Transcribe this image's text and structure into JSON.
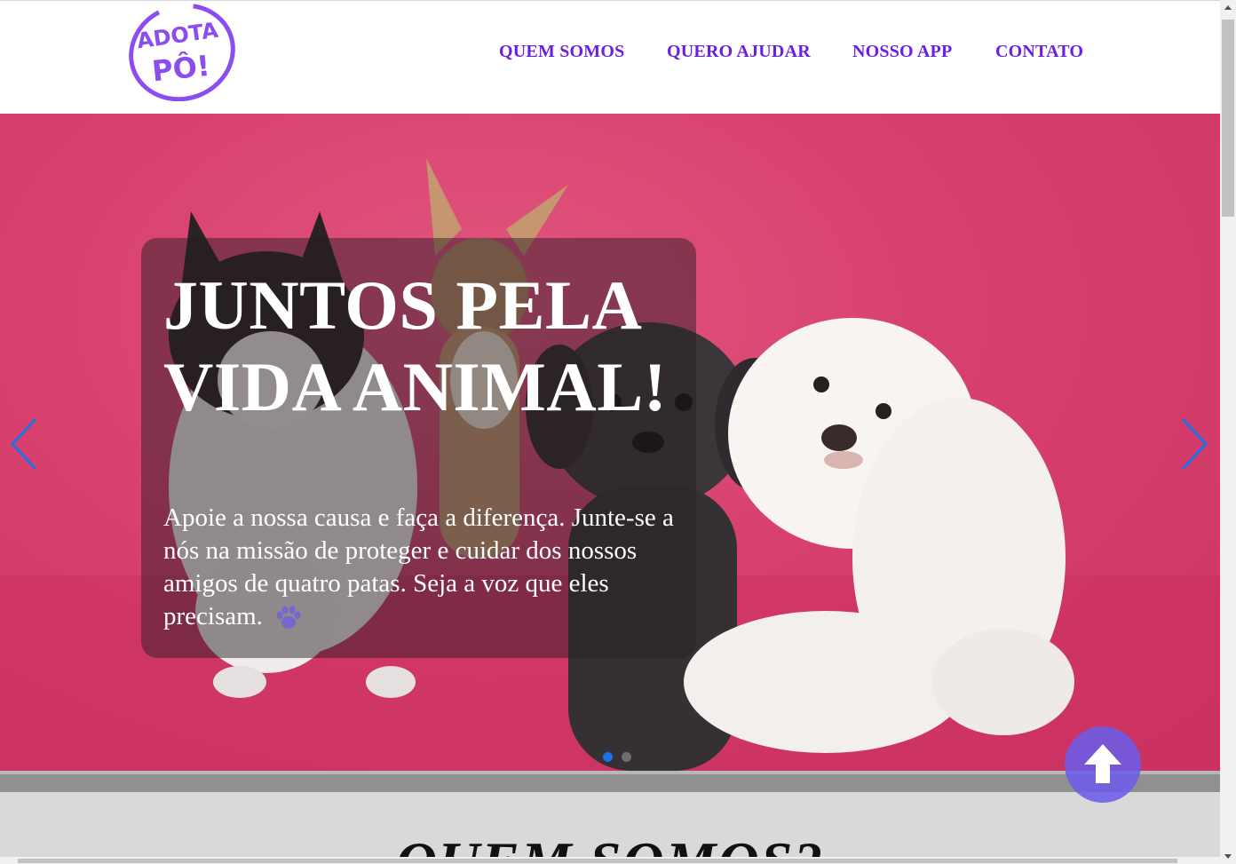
{
  "brand": {
    "logo_line1": "ADOTA",
    "logo_line2": "PÔ!",
    "accent_color": "#6a1ee6",
    "logo_yellow": "#f6d31c"
  },
  "nav": {
    "items": [
      {
        "label": "QUEM SOMOS"
      },
      {
        "label": "QUERO AJUDAR"
      },
      {
        "label": "NOSSO APP"
      },
      {
        "label": "CONTATO"
      }
    ]
  },
  "hero": {
    "title": "JUNTOS PELA VIDA ANIMAL!",
    "text": "Apoie a nossa causa e faça a diferença. Junte-se a nós na missão de proteger e cuidar dos nossos amigos de quatro patas. Seja a voz que eles precisam.",
    "background_color": "#d8406e",
    "arrow_color": "#1a73e8",
    "prev_icon": "chevron-left-icon",
    "next_icon": "chevron-right-icon",
    "slide_count": 2,
    "active_slide": 1
  },
  "about": {
    "title": "QUEM SOMOS?"
  },
  "back_to_top": {
    "icon": "arrow-up-icon",
    "color": "#6c5ce7"
  }
}
